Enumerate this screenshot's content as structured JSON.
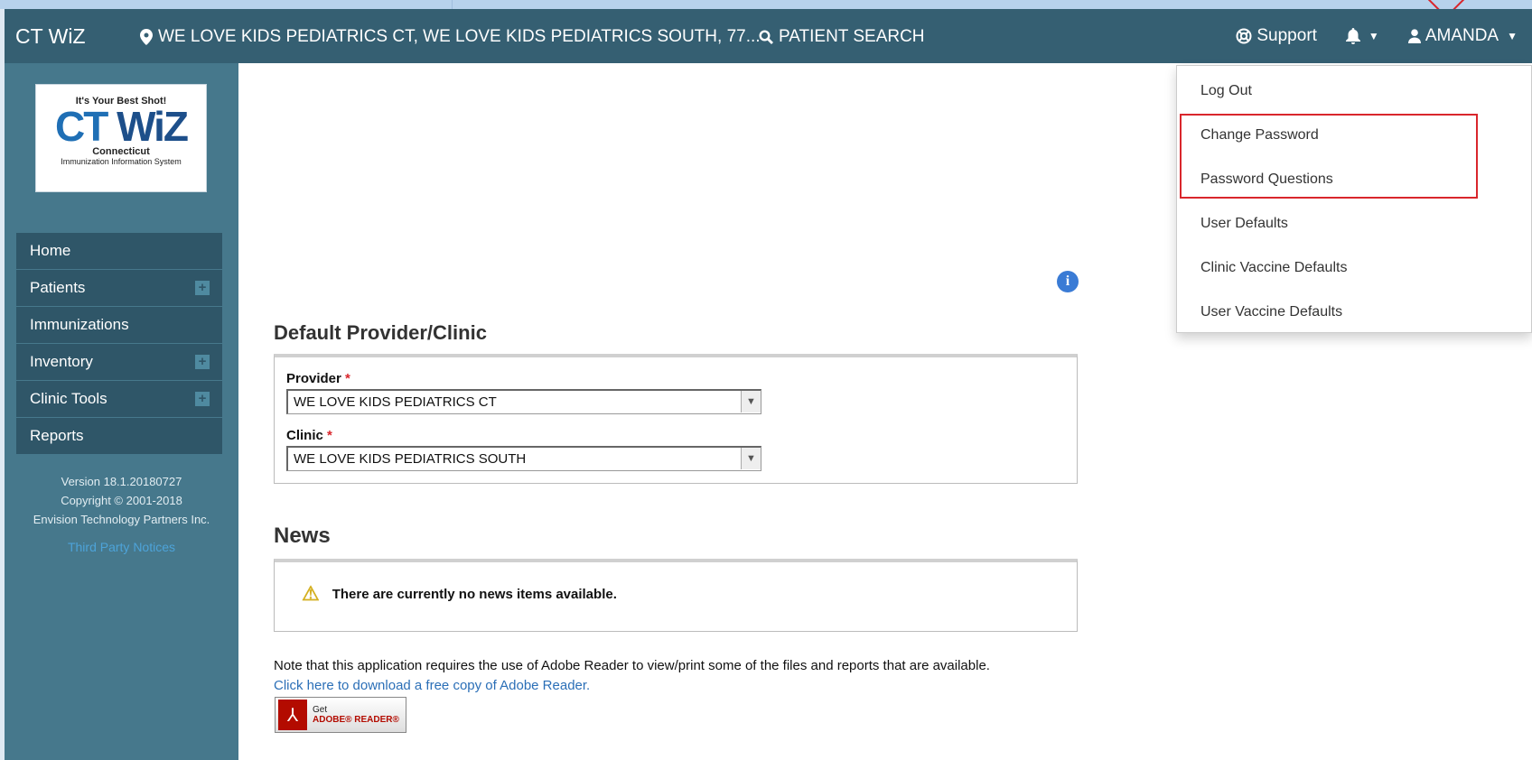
{
  "navbar": {
    "brand": "CT WiZ",
    "location": "WE LOVE KIDS PEDIATRICS CT, WE LOVE KIDS PEDIATRICS SOUTH, 77...",
    "patient_search": "PATIENT SEARCH",
    "support": "Support",
    "user": "AMANDA"
  },
  "sidebar": {
    "logo": {
      "tagline": "It's Your Best Shot!",
      "ct": "CT",
      "wiz": "WiZ",
      "state": "Connecticut",
      "system": "Immunization Information System"
    },
    "items": [
      {
        "label": "Home"
      },
      {
        "label": "Patients"
      },
      {
        "label": "Immunizations"
      },
      {
        "label": "Inventory"
      },
      {
        "label": "Clinic Tools"
      },
      {
        "label": "Reports"
      }
    ],
    "version": "Version 18.1.20180727",
    "copyright": "Copyright © 2001-2018",
    "company": "Envision Technology Partners Inc.",
    "third_party": "Third Party Notices"
  },
  "main": {
    "default_title": "Default Provider/Clinic",
    "provider_label": "Provider",
    "provider_value": "WE LOVE KIDS PEDIATRICS CT",
    "clinic_label": "Clinic",
    "clinic_value": "WE LOVE KIDS PEDIATRICS SOUTH",
    "required_mark": "*",
    "news_title": "News",
    "news_empty": "There are currently no news items available.",
    "adobe_note": "Note that this application requires the use of Adobe Reader to view/print some of the files and reports that are available.",
    "adobe_link": "Click here to download a free copy of Adobe Reader.",
    "adobe_badge_get": "Get",
    "adobe_badge_name": "ADOBE® READER®"
  },
  "user_menu": {
    "items": [
      {
        "label": "Log Out"
      },
      {
        "label": "Change Password"
      },
      {
        "label": "Password Questions"
      },
      {
        "label": "User Defaults"
      },
      {
        "label": "Clinic Vaccine Defaults"
      },
      {
        "label": "User Vaccine Defaults"
      }
    ]
  },
  "colors": {
    "navbar": "#355f72",
    "sidebar": "#46788c",
    "menu_item": "#2f5668",
    "highlight": "#d9262c",
    "link": "#2b6fb7"
  },
  "icons": {
    "location": "map-marker-icon",
    "search": "search-icon",
    "support": "life-ring-icon",
    "bell": "bell-icon",
    "user": "user-icon",
    "info": "info-circle-icon",
    "warning": "warning-icon",
    "pdf": "pdf-icon"
  }
}
